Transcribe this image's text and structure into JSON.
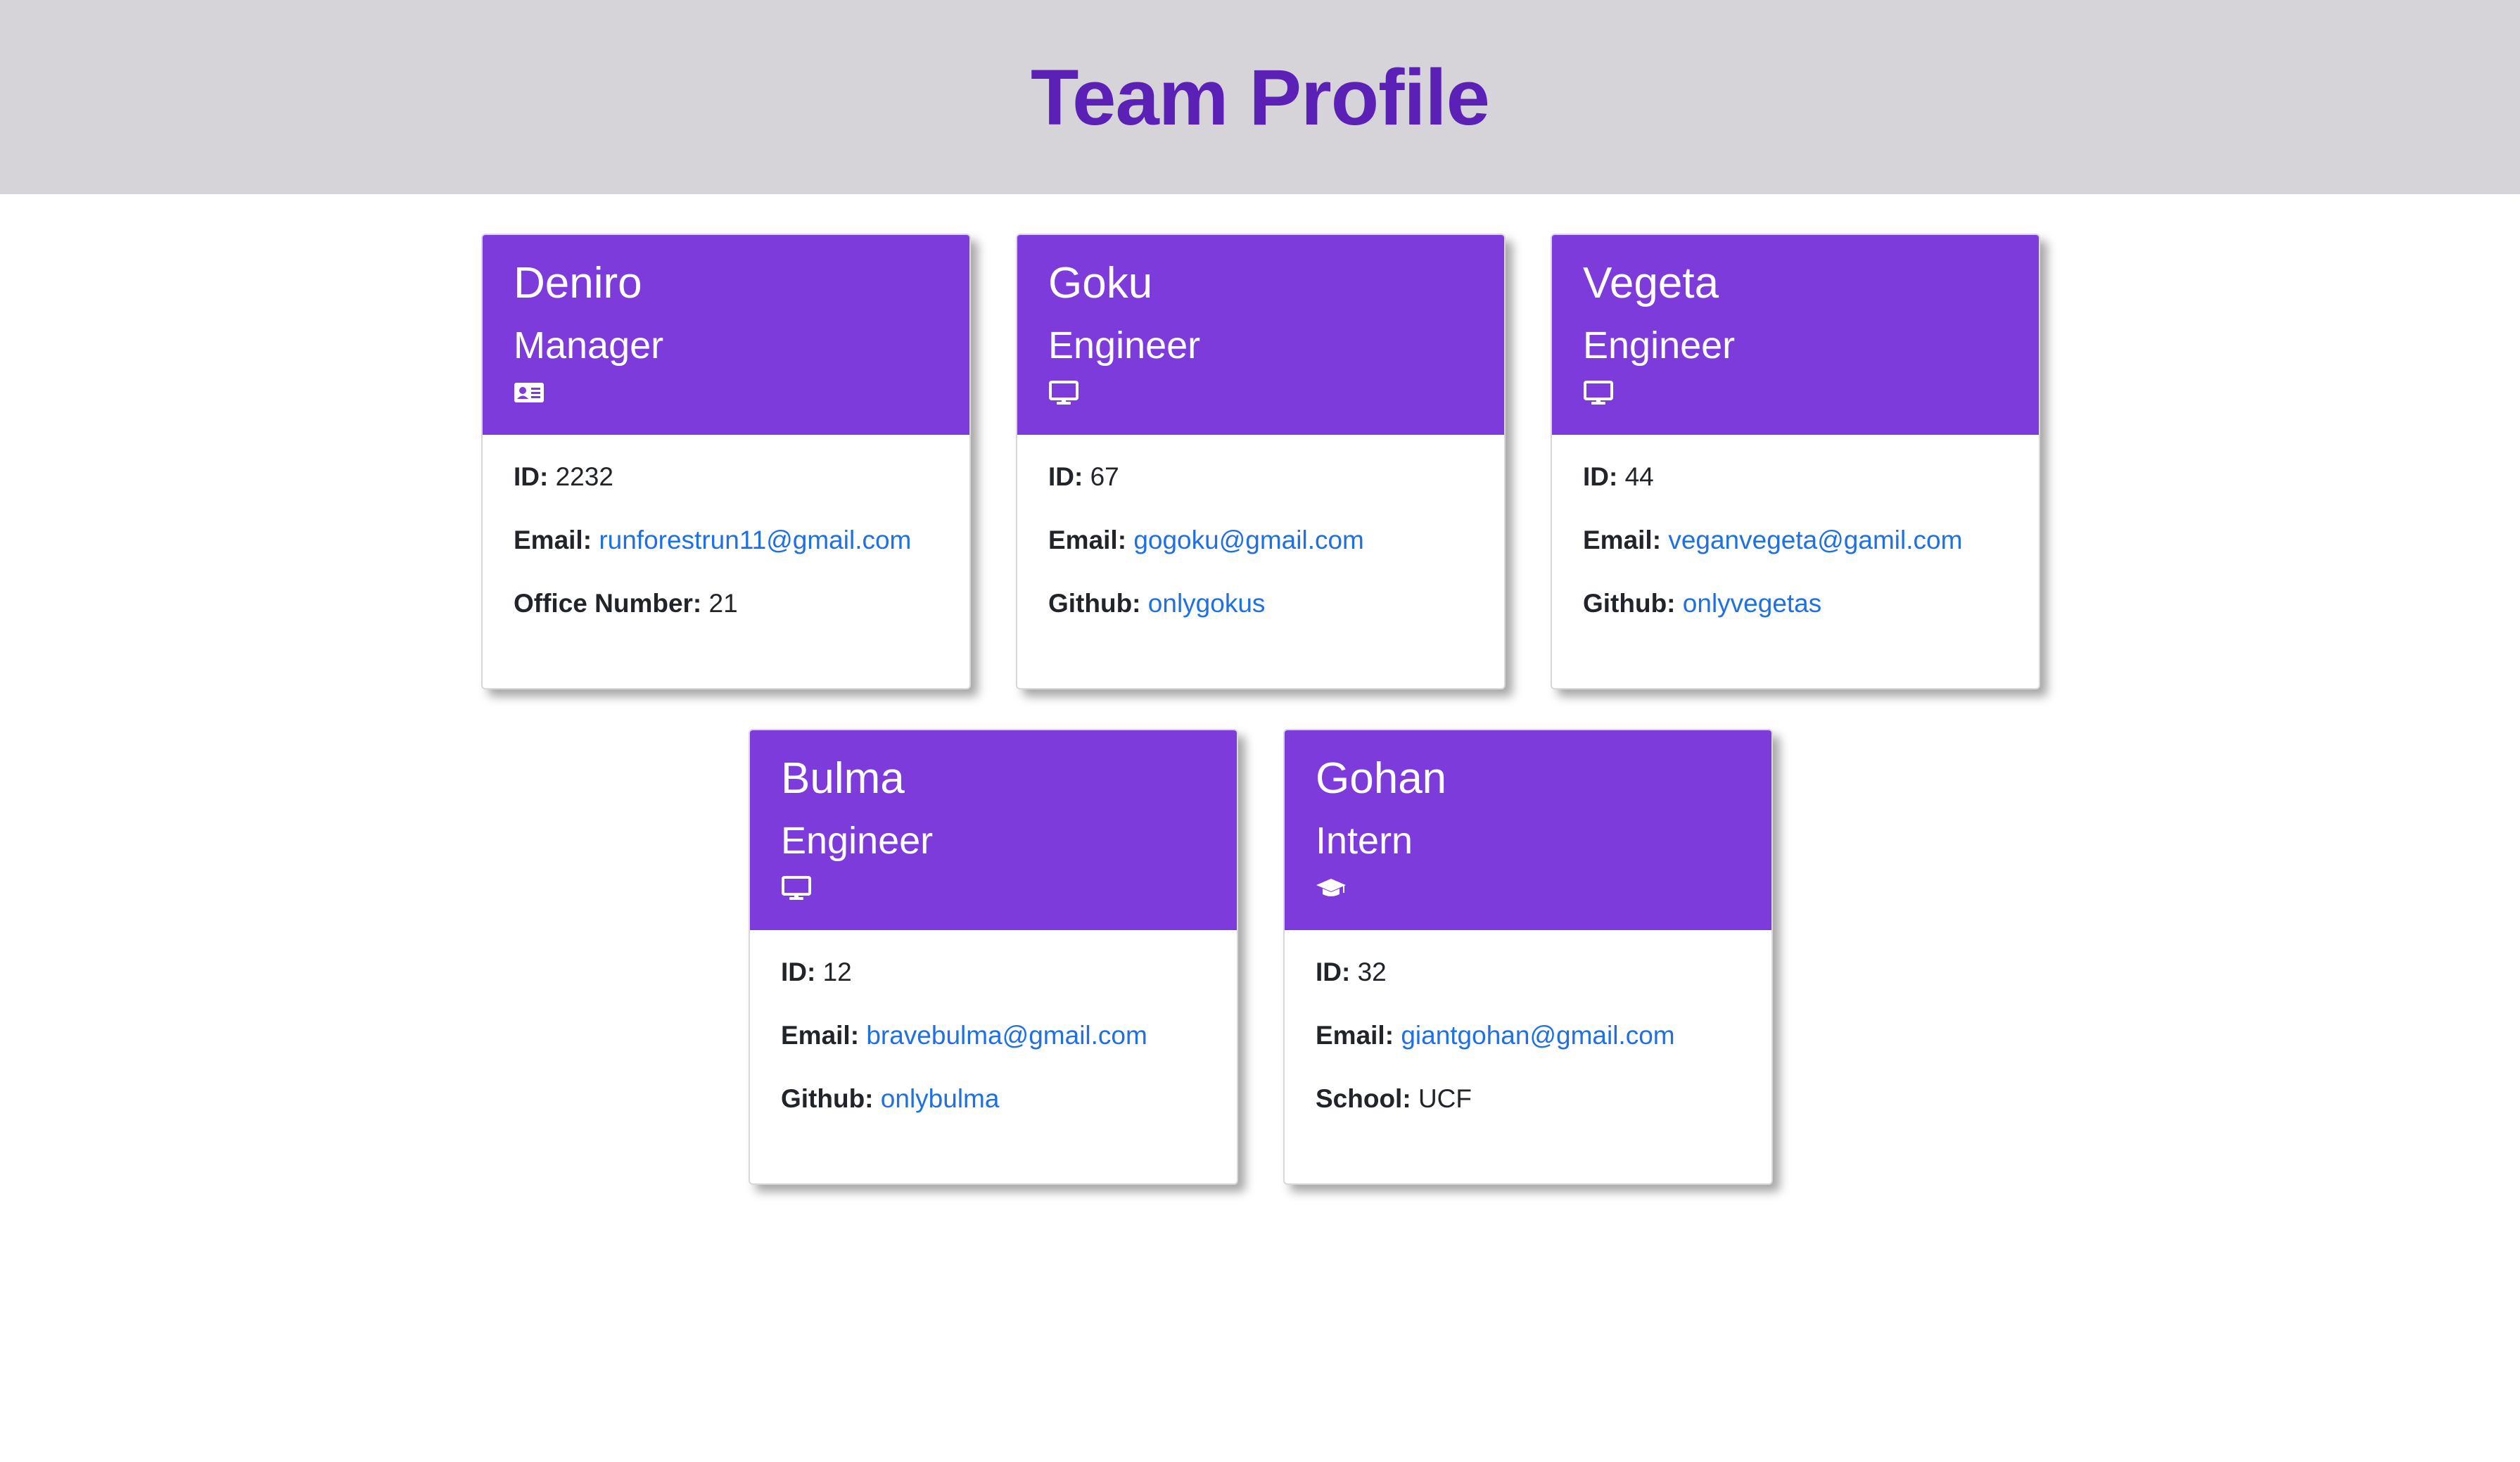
{
  "header": {
    "title": "Team Profile"
  },
  "colors": {
    "header_bg": "#d6d4d9",
    "title": "#5b21b6",
    "card_head": "#7e3bdc",
    "link": "#1f6fe5"
  },
  "cards": [
    {
      "name": "Deniro",
      "role": "Manager",
      "icon": "id-card-icon",
      "id_label": "ID:",
      "id_value": "2232",
      "email_label": "Email:",
      "email_value": "runforestrun11@gmail.com",
      "extra_label": "Office Number:",
      "extra_value": "21"
    },
    {
      "name": "Goku",
      "role": "Engineer",
      "icon": "monitor-icon",
      "id_label": "ID:",
      "id_value": "67",
      "email_label": "Email:",
      "email_value": "gogoku@gmail.com",
      "extra_label": "Github:",
      "extra_value": "onlygokus"
    },
    {
      "name": "Vegeta",
      "role": "Engineer",
      "icon": "monitor-icon",
      "id_label": "ID:",
      "id_value": "44",
      "email_label": "Email:",
      "email_value": "veganvegeta@gamil.com",
      "extra_label": "Github:",
      "extra_value": "onlyvegetas"
    },
    {
      "name": "Bulma",
      "role": "Engineer",
      "icon": "monitor-icon",
      "id_label": "ID:",
      "id_value": "12",
      "email_label": "Email:",
      "email_value": "bravebulma@gmail.com",
      "extra_label": "Github:",
      "extra_value": "onlybulma"
    },
    {
      "name": "Gohan",
      "role": "Intern",
      "icon": "graduation-cap-icon",
      "id_label": "ID:",
      "id_value": "32",
      "email_label": "Email:",
      "email_value": "giantgohan@gmail.com",
      "extra_label": "School:",
      "extra_value": "UCF"
    }
  ]
}
